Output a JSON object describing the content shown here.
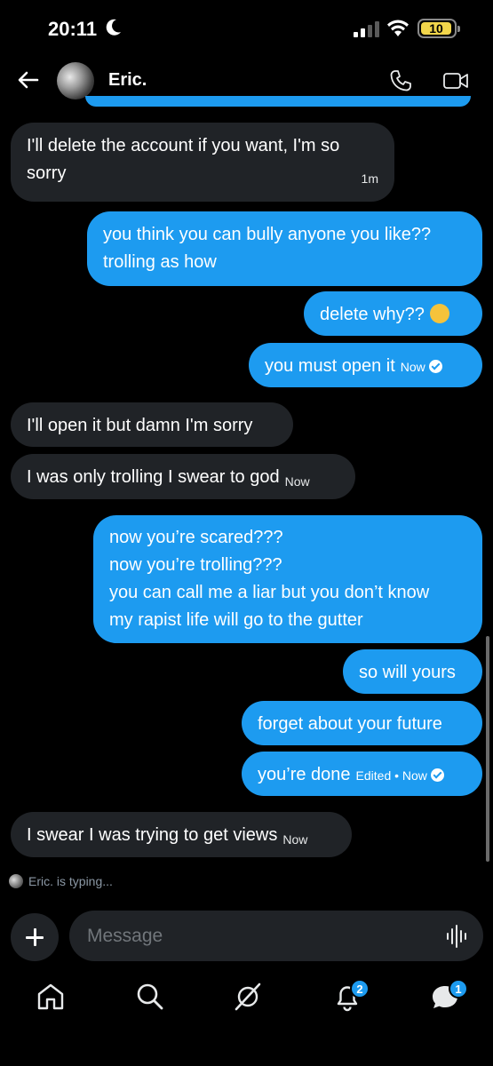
{
  "status_bar": {
    "time": "20:11",
    "battery_level": "10",
    "icons": [
      "moon-icon",
      "signal-icon",
      "wifi-icon",
      "battery-icon"
    ]
  },
  "header": {
    "contact_name": "Eric.",
    "icons": [
      "back-arrow-icon",
      "phone-icon",
      "video-icon"
    ]
  },
  "messages": [
    {
      "side": "in",
      "text": "I'll delete the account if you want, I'm so sorry",
      "meta": "1m"
    },
    {
      "side": "out",
      "text": "you think you can bully anyone you like?? trolling as how"
    },
    {
      "side": "out",
      "text": "delete why??",
      "emoji": "laughing-crying-emoji"
    },
    {
      "side": "out",
      "text": "you must open it",
      "meta": "Now",
      "read": true
    },
    {
      "side": "in",
      "text": "I'll open it but damn I'm sorry"
    },
    {
      "side": "in",
      "text": "I was only trolling I swear to god",
      "meta": "Now"
    },
    {
      "side": "out",
      "lines": [
        "now you’re scared???",
        "now you’re trolling???",
        "you can call me a liar but you don’t know",
        "my rapist life will go to the gutter"
      ]
    },
    {
      "side": "out",
      "text": "so will yours"
    },
    {
      "side": "out",
      "text": "forget about your future"
    },
    {
      "side": "out",
      "text": "you’re done",
      "meta": "Edited • Now",
      "read": true
    },
    {
      "side": "in",
      "text": "I swear I was trying to get views",
      "meta": "Now"
    }
  ],
  "typing_indicator": "Eric. is typing...",
  "composer": {
    "placeholder": "Message",
    "icons": [
      "plus-icon",
      "voice-icon"
    ]
  },
  "bottom_nav": {
    "items": [
      "home-icon",
      "search-icon",
      "grok-icon",
      "notifications-icon",
      "messages-icon"
    ],
    "notifications_badge": "2",
    "messages_badge": "1"
  },
  "colors": {
    "background": "#000000",
    "outgoing_bubble": "#1d9bf0",
    "incoming_bubble": "#202327",
    "secondary_text": "#71767b"
  }
}
